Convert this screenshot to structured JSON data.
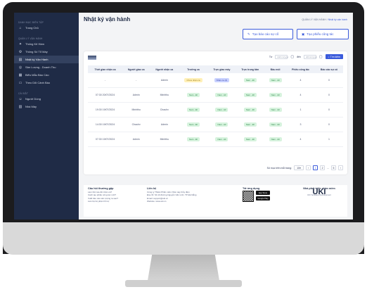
{
  "sidebar": {
    "groups": [
      {
        "label": "DANH MỤC BIÊN TẬP",
        "items": [
          {
            "label": "Trang Chủ",
            "icon": "home-icon"
          }
        ]
      },
      {
        "label": "QUẢN LÝ VẬN HÀNH",
        "items": [
          {
            "label": "Thống Kê Hầm",
            "icon": "chart-icon"
          },
          {
            "label": "Thông Số Tổ Máy",
            "icon": "gear-icon"
          },
          {
            "label": "Nhật ký Vận Hành",
            "icon": "book-icon",
            "active": true
          },
          {
            "label": "Sản Lượng - Doanh Thu",
            "icon": "coin-icon"
          },
          {
            "label": "Biểu Mẫu Báo Cáo",
            "icon": "grid-icon"
          },
          {
            "label": "Theo Dõi Cảnh Báo",
            "icon": "monitor-icon"
          }
        ]
      },
      {
        "label": "CÀI ĐẶT",
        "items": [
          {
            "label": "Người Dùng",
            "icon": "users-icon"
          },
          {
            "label": "Nhà Máy",
            "icon": "factory-icon"
          }
        ]
      }
    ]
  },
  "header": {
    "title": "Nhật ký vận hành",
    "breadcrumb_root": "QUẢN LÝ VẬN HÀNH",
    "breadcrumb_sep": "/",
    "breadcrumb_current": "Nhật ký vận hành"
  },
  "actions": {
    "report_incident": "Tạo báo cáo sự cố",
    "create_shift_slip": "Tạo phiếu công tác"
  },
  "filters": {
    "from_label": "Từ",
    "from_placeholder": "dd/mm/yyyy",
    "to_label": "đến",
    "to_placeholder": "dd/mm/yyyy",
    "search_label": "Tìm kiếm"
  },
  "table": {
    "headers": [
      "Thời gian nhận ca",
      "Người giao ca",
      "Người nhận ca",
      "Trưởng ca",
      "Trực giao máy",
      "Trực trung tâm",
      "Đầu mối",
      "Phiếu công tác",
      "Báo cáo sự cố"
    ],
    "rows": [
      {
        "time": "-",
        "giver": "-",
        "receiver": "Admin",
        "leader": "Chưa nhận ca",
        "machine": "Nhận ca (4)",
        "center": "Nam - ĐI",
        "contact": "Nam - ĐI",
        "slips": "4",
        "incidents": "0"
      },
      {
        "time": "07:30 20/07/2024",
        "giver": "Admin",
        "receiver": "Minhthu",
        "leader": "Nam - ĐI",
        "machine": "Nam - ĐI",
        "center": "Nam - ĐI",
        "contact": "Nam - ĐI",
        "slips": "4",
        "incidents": "0"
      },
      {
        "time": "19:30 19/07/2024",
        "giver": "Minhthu",
        "receiver": "Chauhv",
        "leader": "Nam - ĐI",
        "machine": "Nam - ĐI",
        "center": "Nam - ĐI",
        "contact": "Nam - ĐI",
        "slips": "1",
        "incidents": "0"
      },
      {
        "time": "14:30 19/07/2024",
        "giver": "Chauhv",
        "receiver": "Admin",
        "leader": "Nam - ĐI",
        "machine": "Nam - ĐI",
        "center": "Nam - ĐI",
        "contact": "Nam - ĐI",
        "slips": "3",
        "incidents": "0"
      },
      {
        "time": "07:30 19/07/2024",
        "giver": "Admin",
        "receiver": "Minhthu",
        "leader": "Nam - ĐI",
        "machine": "Nam - ĐI",
        "center": "Nam - ĐI",
        "contact": "Nam - ĐI",
        "slips": "4",
        "incidents": "1"
      }
    ]
  },
  "pagination": {
    "per_page_label": "Số mục trên mỗi trang:",
    "per_page_value": "10",
    "prev": "‹",
    "pages": [
      "1",
      "2"
    ],
    "ellipsis": "...",
    "last": "5",
    "next": "›"
  },
  "footer": {
    "faq_title": "Câu hỏi thường gặp",
    "faq_items": [
      "Làm thế nào để nhận ca?",
      "Cách tạo phiếu công tác mới?",
      "Xuất báo cáo sản lượng ra sao?",
      "Liên hệ bộ phận hỗ trợ"
    ],
    "contact_title": "Liên hệ",
    "contact_items": [
      "Công ty TNHH Phần mềm Nhà máy thủy điện",
      "Địa chỉ: Số 10 đường Nguyễn Văn Linh, TP Đà Nẵng",
      "Email: support@uki.vn",
      "Website: www.uki.vn"
    ],
    "download_title": "Tải ứng dụng",
    "app_store": "App Store",
    "google_play": "Google Play",
    "brand_title": "Nhà phát triển phần mềm",
    "brand_logo": "UKI",
    "brand_sub": "UKI Software Development"
  }
}
